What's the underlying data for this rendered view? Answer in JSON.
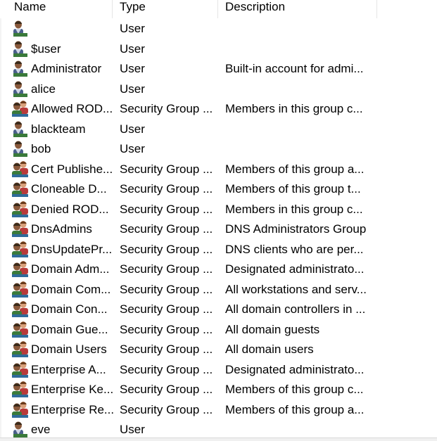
{
  "columns": {
    "name": "Name",
    "type": "Type",
    "description": "Description"
  },
  "rows": [
    {
      "icon": "user-icon",
      "name": "",
      "type": "User",
      "description": ""
    },
    {
      "icon": "user-icon",
      "name": "$user",
      "type": "User",
      "description": ""
    },
    {
      "icon": "user-icon",
      "name": "Administrator",
      "type": "User",
      "description": "Built-in account for admi..."
    },
    {
      "icon": "user-icon",
      "name": "alice",
      "type": "User",
      "description": ""
    },
    {
      "icon": "group-icon",
      "name": "Allowed ROD...",
      "type": "Security Group ...",
      "description": "Members in this group c..."
    },
    {
      "icon": "user-icon",
      "name": "blackteam",
      "type": "User",
      "description": ""
    },
    {
      "icon": "user-icon",
      "name": "bob",
      "type": "User",
      "description": ""
    },
    {
      "icon": "group-icon",
      "name": "Cert Publishe...",
      "type": "Security Group ...",
      "description": "Members of this group a..."
    },
    {
      "icon": "group-icon",
      "name": "Cloneable D...",
      "type": "Security Group ...",
      "description": "Members of this group t..."
    },
    {
      "icon": "group-icon",
      "name": "Denied ROD...",
      "type": "Security Group ...",
      "description": "Members in this group c..."
    },
    {
      "icon": "group-icon",
      "name": "DnsAdmins",
      "type": "Security Group ...",
      "description": "DNS Administrators Group"
    },
    {
      "icon": "group-icon",
      "name": "DnsUpdatePr...",
      "type": "Security Group ...",
      "description": "DNS clients who are per..."
    },
    {
      "icon": "group-icon",
      "name": "Domain Adm...",
      "type": "Security Group ...",
      "description": "Designated administrato..."
    },
    {
      "icon": "group-icon",
      "name": "Domain Com...",
      "type": "Security Group ...",
      "description": "All workstations and serv..."
    },
    {
      "icon": "group-icon",
      "name": "Domain Con...",
      "type": "Security Group ...",
      "description": "All domain controllers in ..."
    },
    {
      "icon": "group-icon",
      "name": "Domain Gue...",
      "type": "Security Group ...",
      "description": "All domain guests"
    },
    {
      "icon": "group-icon",
      "name": "Domain Users",
      "type": "Security Group ...",
      "description": "All domain users"
    },
    {
      "icon": "group-icon",
      "name": "Enterprise A...",
      "type": "Security Group ...",
      "description": "Designated administrato..."
    },
    {
      "icon": "group-icon",
      "name": "Enterprise Ke...",
      "type": "Security Group ...",
      "description": "Members of this group c..."
    },
    {
      "icon": "group-icon",
      "name": "Enterprise Re...",
      "type": "Security Group ...",
      "description": "Members of this group a..."
    },
    {
      "icon": "user-icon",
      "name": "eve",
      "type": "User",
      "description": ""
    }
  ]
}
